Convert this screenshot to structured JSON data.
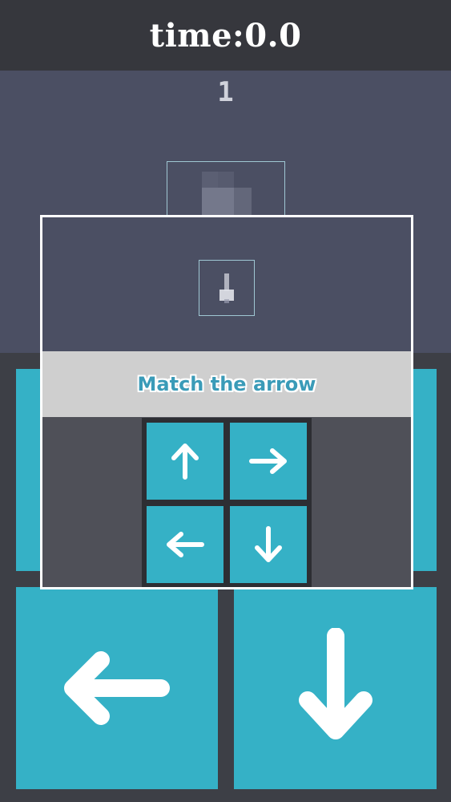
{
  "header": {
    "timer_text": "time:0.0"
  },
  "game": {
    "level": "1",
    "target_arrow": "down-arrow-icon",
    "background_buttons": [
      "left-arrow-icon",
      "down-arrow-icon"
    ]
  },
  "overlay": {
    "instruction": "Match the arrow",
    "example_arrow": "down-arrow-icon",
    "buttons": [
      "up-arrow-icon",
      "right-arrow-icon",
      "left-arrow-icon",
      "down-arrow-icon"
    ]
  },
  "colors": {
    "accent": "#35b1c6",
    "topbar": "#36373d",
    "playfield": "#4b4f63",
    "banner": "#cfcfcf",
    "banner_text": "#3a9bb8"
  }
}
